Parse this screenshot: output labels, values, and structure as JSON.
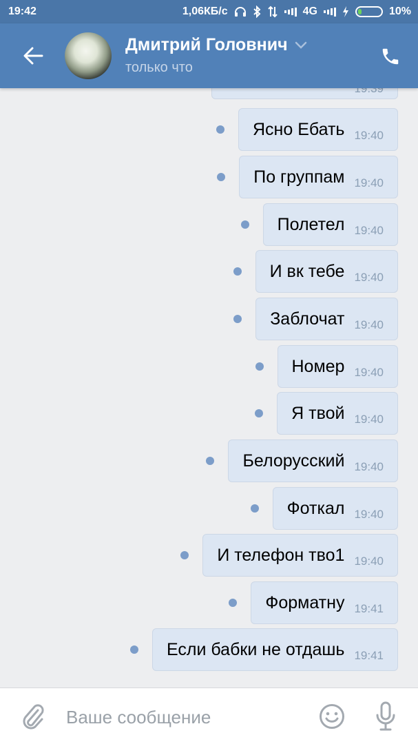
{
  "status_bar": {
    "time": "19:42",
    "speed": "1,06КБ/с",
    "network": "4G",
    "battery": "10%"
  },
  "header": {
    "contact_name": "Дмитрий Головнич",
    "contact_status": "только что"
  },
  "partial_message": {
    "time": "19:39"
  },
  "messages": [
    {
      "text": "Ясно Ебать",
      "time": "19:40"
    },
    {
      "text": "По группам",
      "time": "19:40"
    },
    {
      "text": "Полетел",
      "time": "19:40"
    },
    {
      "text": "И вк тебе",
      "time": "19:40"
    },
    {
      "text": "Заблочат",
      "time": "19:40"
    },
    {
      "text": "Номер",
      "time": "19:40"
    },
    {
      "text": "Я твой",
      "time": "19:40"
    },
    {
      "text": "Белорусский",
      "time": "19:40"
    },
    {
      "text": "Фоткал",
      "time": "19:40"
    },
    {
      "text": "И телефон тво1",
      "time": "19:40"
    },
    {
      "text": "Форматну",
      "time": "19:41"
    },
    {
      "text": "Если бабки не отдашь",
      "time": "19:41"
    }
  ],
  "input": {
    "placeholder": "Ваше сообщение",
    "value": ""
  },
  "icons": {
    "back": "arrow-left-icon",
    "call": "phone-icon",
    "attach": "paperclip-icon",
    "emoji": "smile-icon",
    "mic": "microphone-icon"
  },
  "colors": {
    "header_bg": "#5181b8",
    "status_bar_bg": "#4a76a8",
    "bubble_bg": "#dce6f3",
    "unread_dot": "#7c9dc9",
    "chat_bg": "#edeef0"
  }
}
